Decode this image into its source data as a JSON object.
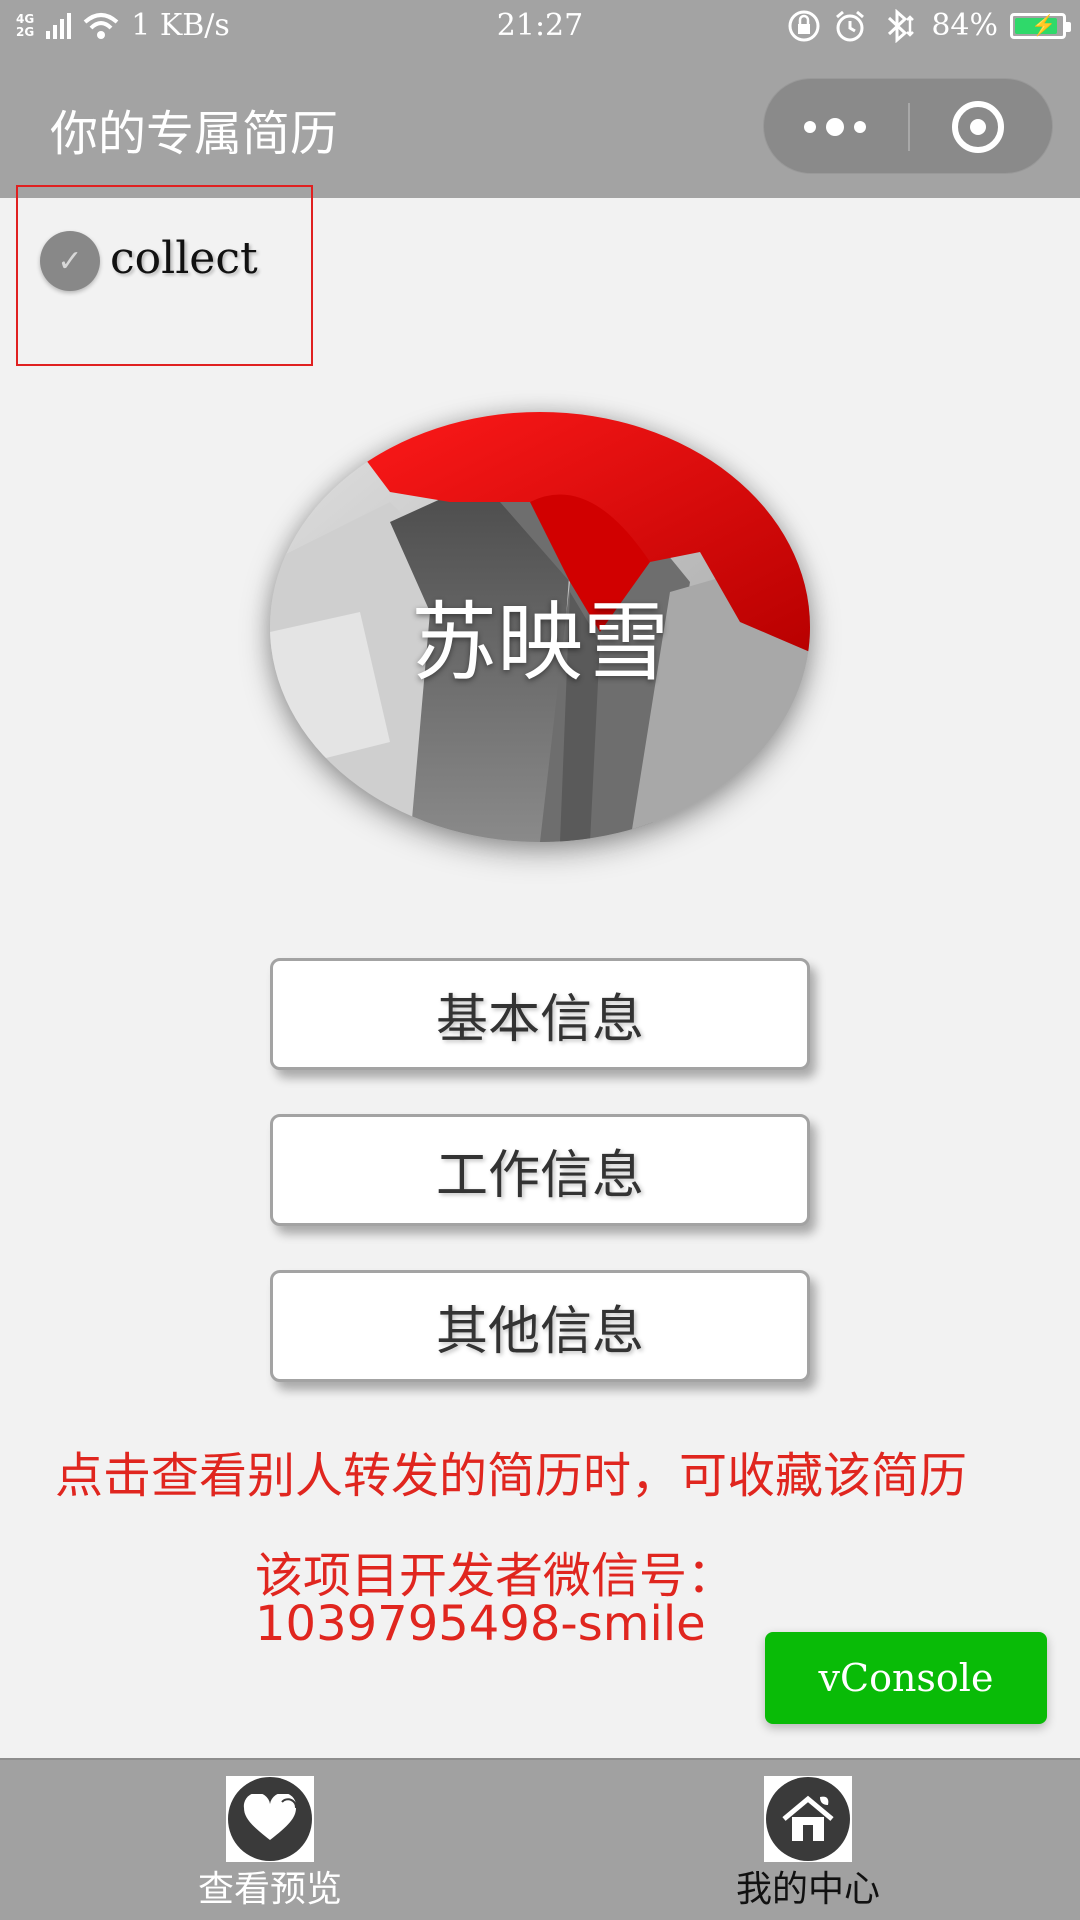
{
  "status_bar": {
    "network": "4G",
    "network_secondary": "2G",
    "speed": "1 KB/s",
    "time": "21:27",
    "battery_percent": "84%",
    "battery_level": 0.84,
    "icons": [
      "signal-icon",
      "wifi-icon",
      "lock-rotation-icon",
      "alarm-icon",
      "bluetooth-icon",
      "battery-icon"
    ]
  },
  "nav": {
    "title": "你的专属简历"
  },
  "collect": {
    "label": "collect",
    "checked": true
  },
  "profile": {
    "name": "苏映雪"
  },
  "menu": {
    "basic": "基本信息",
    "work": "工作信息",
    "other": "其他信息"
  },
  "notes": {
    "hint": "点击查看别人转发的简历时，可收藏该简历",
    "dev_label": "该项目开发者微信号：",
    "dev_id": "1039795498-smile"
  },
  "vconsole": {
    "label": "vConsole",
    "color": "#09bb07"
  },
  "tab_bar": {
    "items": [
      {
        "label": "查看预览",
        "icon": "heart-icon"
      },
      {
        "label": "我的中心",
        "icon": "home-icon"
      }
    ]
  },
  "colors": {
    "bar_gray": "#a3a3a3",
    "note_red": "#e0261f",
    "highlight_border": "#e02020"
  }
}
